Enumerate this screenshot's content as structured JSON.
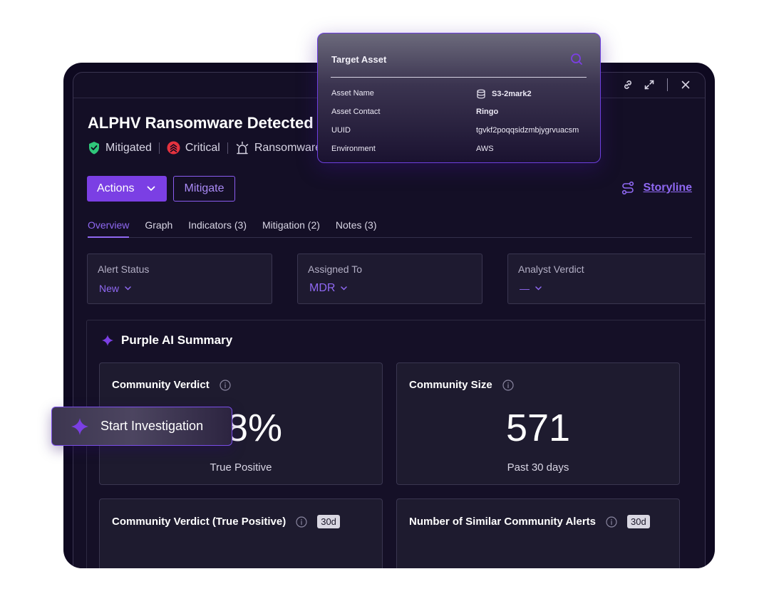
{
  "alert": {
    "title": "ALPHV Ransomware Detected",
    "status": "Mitigated",
    "severity": "Critical",
    "category": "Ransomware"
  },
  "buttons": {
    "actions": "Actions",
    "mitigate": "Mitigate",
    "storyline": "Storyline"
  },
  "tabs": [
    {
      "label": "Overview",
      "active": true
    },
    {
      "label": "Graph"
    },
    {
      "label": "Indicators (3)"
    },
    {
      "label": "Mitigation (2)"
    },
    {
      "label": "Notes (3)"
    }
  ],
  "fields": {
    "alert_status": {
      "label": "Alert Status",
      "value": "New"
    },
    "assigned_to": {
      "label": "Assigned To",
      "value": "MDR"
    },
    "analyst_verdict": {
      "label": "Analyst Verdict",
      "value": "—"
    }
  },
  "summary": {
    "title": "Purple AI Summary",
    "cards": [
      {
        "title": "Community Verdict",
        "value": "8%",
        "sub": "True Positive"
      },
      {
        "title": "Community Size",
        "value": "571",
        "sub": "Past 30 days"
      },
      {
        "title": "Community Verdict (True Positive)",
        "badge": "30d"
      },
      {
        "title": "Number of Similar Community Alerts",
        "badge": "30d"
      }
    ]
  },
  "popup": {
    "title": "Target Asset",
    "rows": [
      {
        "key": "Asset Name",
        "value": "S3-2mark2"
      },
      {
        "key": "Asset Contact",
        "value": "Ringo"
      },
      {
        "key": "UUID",
        "value": "tgvkf2poqqsidzmbjygrvuacsm"
      },
      {
        "key": "Environment",
        "value": "AWS"
      }
    ]
  },
  "floating": {
    "start_investigation": "Start Investigation"
  },
  "colors": {
    "accent": "#7b3fe4",
    "accent_text": "#8f68f2",
    "success": "#2fc77a",
    "critical": "#e5323e",
    "background": "#140f26"
  }
}
